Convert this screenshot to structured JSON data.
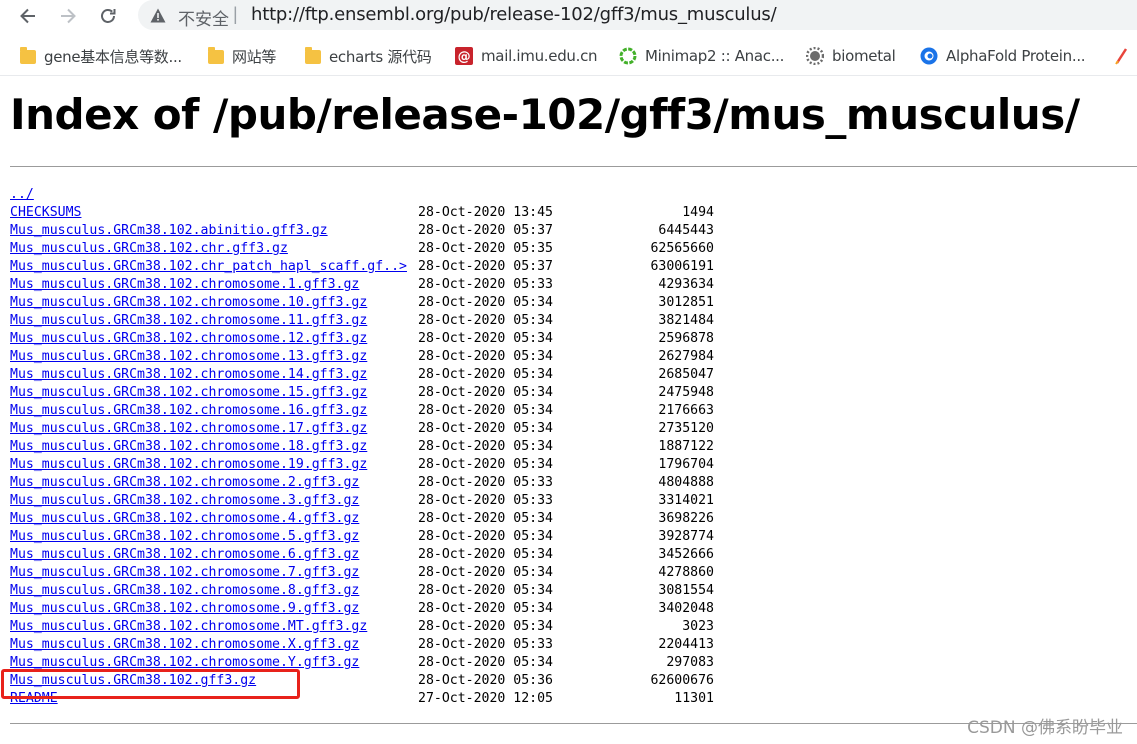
{
  "browser": {
    "security_label": "不安全",
    "separator": "|",
    "url": "http://ftp.ensembl.org/pub/release-102/gff3/mus_musculus/"
  },
  "bookmarks": [
    {
      "label": "gene基本信息等数...",
      "icon": "folder-icon"
    },
    {
      "label": "网站等",
      "icon": "folder-icon"
    },
    {
      "label": "echarts 源代码",
      "icon": "folder-icon"
    },
    {
      "label": "mail.imu.edu.cn",
      "icon": "mail-icon"
    },
    {
      "label": "Minimap2 :: Anac...",
      "icon": "anaconda-icon"
    },
    {
      "label": "biometal",
      "icon": "gear-icon"
    },
    {
      "label": "AlphaFold Protein...",
      "icon": "alphafold-icon"
    }
  ],
  "page": {
    "title": "Index of /pub/release-102/gff3/mus_musculus/",
    "parent_link": "../",
    "entries": [
      {
        "name": "CHECKSUMS",
        "date": "28-Oct-2020 13:45",
        "size": "1494"
      },
      {
        "name": "Mus_musculus.GRCm38.102.abinitio.gff3.gz",
        "date": "28-Oct-2020 05:37",
        "size": "6445443"
      },
      {
        "name": "Mus_musculus.GRCm38.102.chr.gff3.gz",
        "date": "28-Oct-2020 05:35",
        "size": "62565660"
      },
      {
        "name": "Mus_musculus.GRCm38.102.chr_patch_hapl_scaff.gf..>",
        "date": "28-Oct-2020 05:37",
        "size": "63006191"
      },
      {
        "name": "Mus_musculus.GRCm38.102.chromosome.1.gff3.gz",
        "date": "28-Oct-2020 05:33",
        "size": "4293634"
      },
      {
        "name": "Mus_musculus.GRCm38.102.chromosome.10.gff3.gz",
        "date": "28-Oct-2020 05:34",
        "size": "3012851"
      },
      {
        "name": "Mus_musculus.GRCm38.102.chromosome.11.gff3.gz",
        "date": "28-Oct-2020 05:34",
        "size": "3821484"
      },
      {
        "name": "Mus_musculus.GRCm38.102.chromosome.12.gff3.gz",
        "date": "28-Oct-2020 05:34",
        "size": "2596878"
      },
      {
        "name": "Mus_musculus.GRCm38.102.chromosome.13.gff3.gz",
        "date": "28-Oct-2020 05:34",
        "size": "2627984"
      },
      {
        "name": "Mus_musculus.GRCm38.102.chromosome.14.gff3.gz",
        "date": "28-Oct-2020 05:34",
        "size": "2685047"
      },
      {
        "name": "Mus_musculus.GRCm38.102.chromosome.15.gff3.gz",
        "date": "28-Oct-2020 05:34",
        "size": "2475948"
      },
      {
        "name": "Mus_musculus.GRCm38.102.chromosome.16.gff3.gz",
        "date": "28-Oct-2020 05:34",
        "size": "2176663"
      },
      {
        "name": "Mus_musculus.GRCm38.102.chromosome.17.gff3.gz",
        "date": "28-Oct-2020 05:34",
        "size": "2735120"
      },
      {
        "name": "Mus_musculus.GRCm38.102.chromosome.18.gff3.gz",
        "date": "28-Oct-2020 05:34",
        "size": "1887122"
      },
      {
        "name": "Mus_musculus.GRCm38.102.chromosome.19.gff3.gz",
        "date": "28-Oct-2020 05:34",
        "size": "1796704"
      },
      {
        "name": "Mus_musculus.GRCm38.102.chromosome.2.gff3.gz",
        "date": "28-Oct-2020 05:33",
        "size": "4804888"
      },
      {
        "name": "Mus_musculus.GRCm38.102.chromosome.3.gff3.gz",
        "date": "28-Oct-2020 05:33",
        "size": "3314021"
      },
      {
        "name": "Mus_musculus.GRCm38.102.chromosome.4.gff3.gz",
        "date": "28-Oct-2020 05:34",
        "size": "3698226"
      },
      {
        "name": "Mus_musculus.GRCm38.102.chromosome.5.gff3.gz",
        "date": "28-Oct-2020 05:34",
        "size": "3928774"
      },
      {
        "name": "Mus_musculus.GRCm38.102.chromosome.6.gff3.gz",
        "date": "28-Oct-2020 05:34",
        "size": "3452666"
      },
      {
        "name": "Mus_musculus.GRCm38.102.chromosome.7.gff3.gz",
        "date": "28-Oct-2020 05:34",
        "size": "4278860"
      },
      {
        "name": "Mus_musculus.GRCm38.102.chromosome.8.gff3.gz",
        "date": "28-Oct-2020 05:34",
        "size": "3081554"
      },
      {
        "name": "Mus_musculus.GRCm38.102.chromosome.9.gff3.gz",
        "date": "28-Oct-2020 05:34",
        "size": "3402048"
      },
      {
        "name": "Mus_musculus.GRCm38.102.chromosome.MT.gff3.gz",
        "date": "28-Oct-2020 05:34",
        "size": "3023"
      },
      {
        "name": "Mus_musculus.GRCm38.102.chromosome.X.gff3.gz",
        "date": "28-Oct-2020 05:33",
        "size": "2204413"
      },
      {
        "name": "Mus_musculus.GRCm38.102.chromosome.Y.gff3.gz",
        "date": "28-Oct-2020 05:34",
        "size": "297083"
      },
      {
        "name": "Mus_musculus.GRCm38.102.gff3.gz",
        "date": "28-Oct-2020 05:36",
        "size": "62600676"
      },
      {
        "name": "README",
        "date": "27-Oct-2020 12:05",
        "size": "11301"
      }
    ]
  },
  "watermark": "CSDN @佛系盼毕业",
  "colors": {
    "link": "#0000ee",
    "highlight": "#e8221b"
  }
}
